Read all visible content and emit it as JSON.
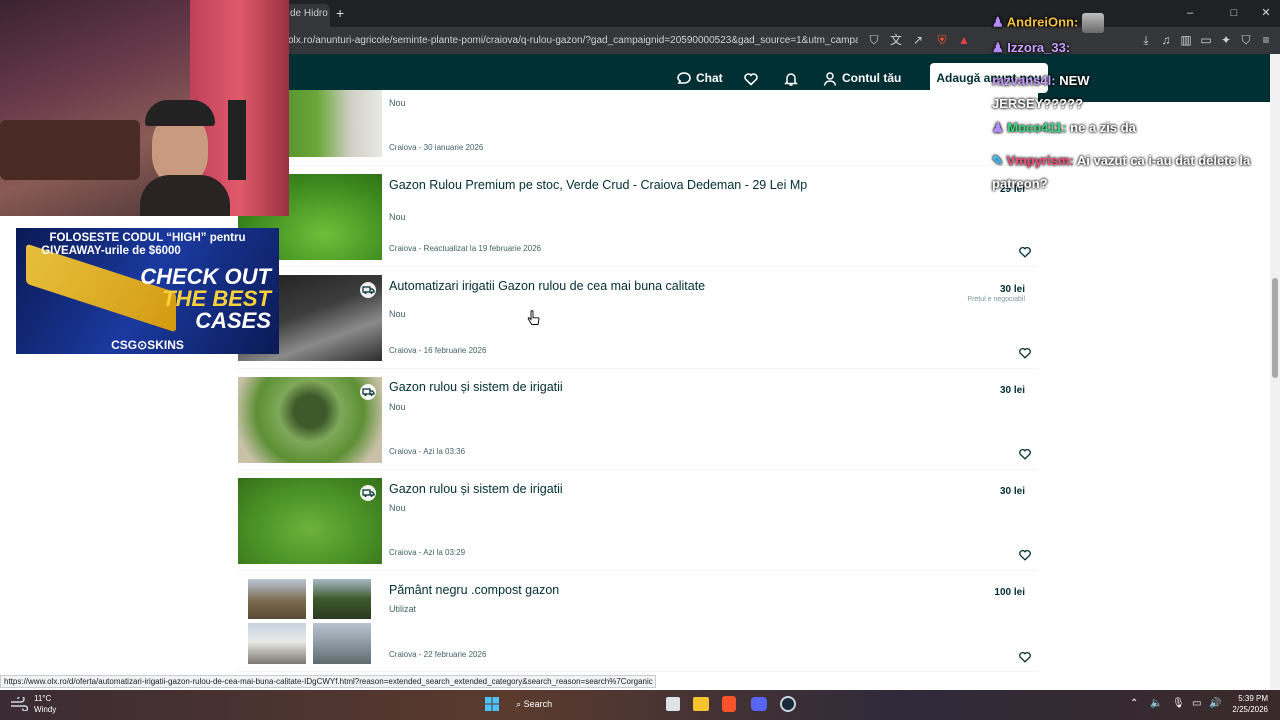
{
  "browser": {
    "tab_title": "de Hidro",
    "new_tab_glyph": "+",
    "url": "olx.ro/anunturi-agricole/seminte-plante-pomi/craiova/q-rulou-gazon/?gad_campaignid=20590000523&gad_source=1&utm_campaign=a...",
    "window_controls": [
      "–",
      "□",
      "✕"
    ],
    "status_url": "https://www.olx.ro/d/oferta/automatizari-irigatii-gazon-rulou-de-cea-mai-buna-calitate-IDgCWYf.html?reason=extended_search_extended_category&search_reason=search%7Corganic"
  },
  "header": {
    "chat_label": "Chat",
    "account_label": "Contul tău",
    "post_button_label": "Adaugă anunț nou"
  },
  "listings": [
    {
      "title": "",
      "condition": "Nou",
      "location": "Craiova - 30 ianuarie 2026",
      "price": "",
      "negotiable": ""
    },
    {
      "title": "Gazon Rulou Premium pe stoc, Verde Crud - Craiova Dedeman - 29 Lei Mp",
      "condition": "Nou",
      "location": "Craiova - Reactualizat la 19 februarie 2026",
      "price": "29 lei",
      "negotiable": ""
    },
    {
      "title": "Automatizari irigatii Gazon rulou de cea mai buna calitate",
      "condition": "Nou",
      "location": "Craiova - 16 februarie 2026",
      "price": "30 lei",
      "negotiable": "Prețul e negociabil"
    },
    {
      "title": "Gazon rulou și sistem de irigatii",
      "condition": "Nou",
      "location": "Craiova - Azi la 03:36",
      "price": "30 lei",
      "negotiable": ""
    },
    {
      "title": "Gazon rulou și sistem de irigatii",
      "condition": "Nou",
      "location": "Craiova - Azi la 03:29",
      "price": "30 lei",
      "negotiable": ""
    },
    {
      "title": "Pământ negru .compost gazon",
      "condition": "Utilizat",
      "location": "Craiova - 22 februarie 2026",
      "price": "100 lei",
      "negotiable": ""
    }
  ],
  "icons": {
    "chat": "chat-bubble-icon",
    "favorites": "heart-icon",
    "notifications": "bell-icon",
    "account": "user-icon",
    "delivery": "delivery-truck-icon"
  },
  "taskbar": {
    "temperature": "11°C",
    "weather": "Windy",
    "search_label": "Search",
    "time": "5:39 PM",
    "date": "2/25/2026"
  },
  "overlay": {
    "promo_line1": "FOLOSESTE CODUL “HIGH” pentru",
    "promo_line2": "GIVEAWAY-urile de $6000",
    "promo_check": "CHECK OUT",
    "promo_best": "THE BEST",
    "promo_cases": "CASES",
    "promo_brand": "CSG⊙SKINS",
    "chat": [
      {
        "user": "AndreiOnn:",
        "message": "",
        "color": "#f5c342"
      },
      {
        "user": "Izzora_33:",
        "message": "",
        "color": "#c9a0ff"
      },
      {
        "user": "razvans4l:",
        "message": "NEW JERSEY?????",
        "color": "#c9a0ff"
      },
      {
        "user": "Moco411:",
        "message": "ne a zis da",
        "color": "#3ddc84"
      },
      {
        "user": "Vmpyrism:",
        "message": "Ai vazut ca i-au dat delete la patreon?",
        "color": "#ff4d7a"
      }
    ]
  },
  "colors": {
    "olx_header": "#002f34",
    "text": "#002f34",
    "muted": "#406367"
  }
}
